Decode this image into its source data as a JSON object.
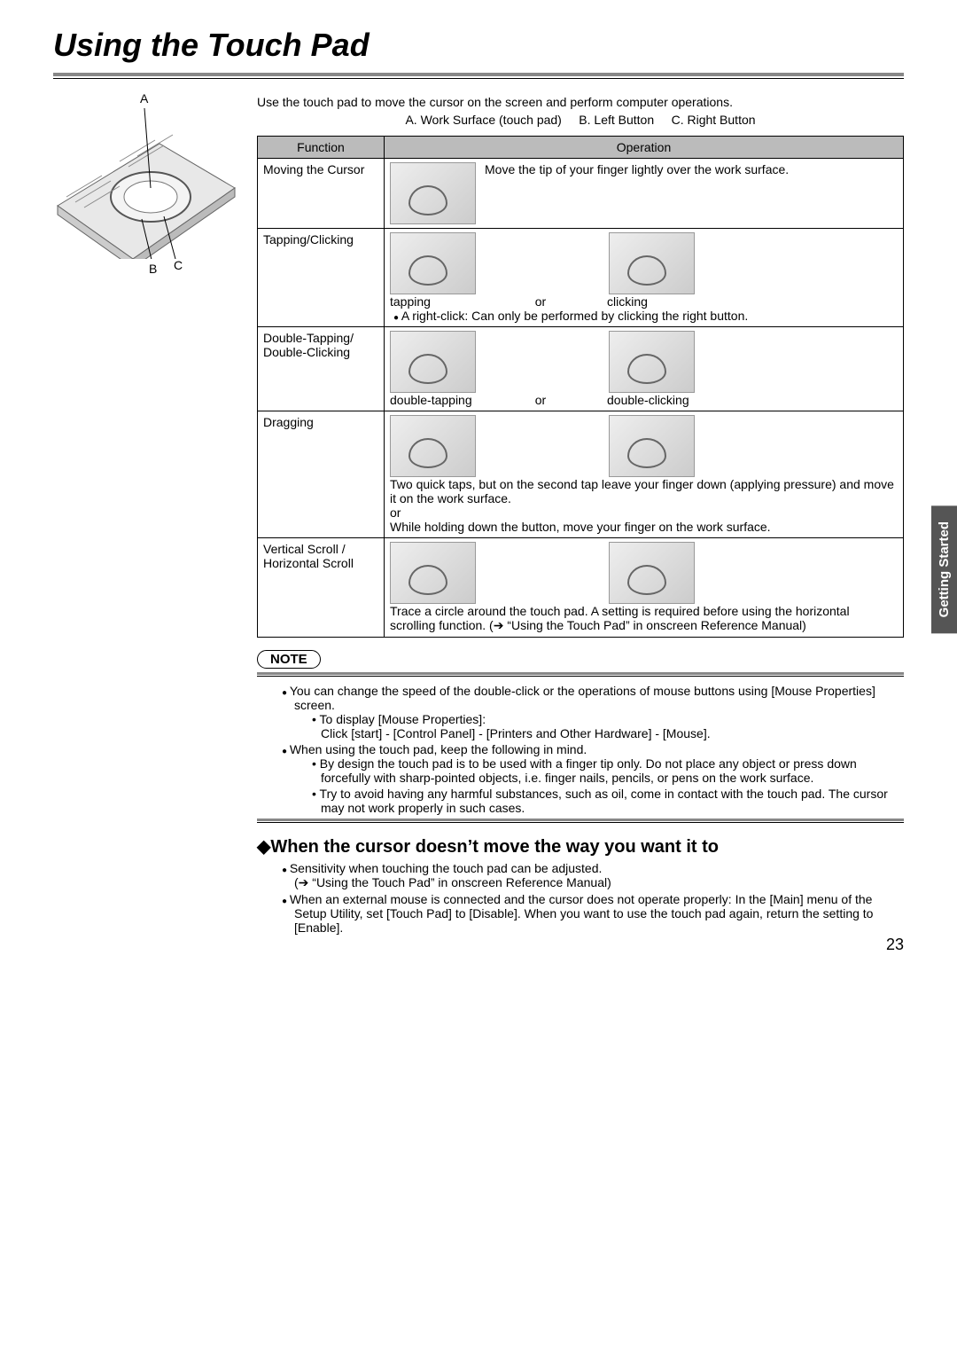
{
  "title": "Using the Touch Pad",
  "side_tab": "Getting Started",
  "page_number": "23",
  "diagram": {
    "labelA": "A",
    "labelB": "B",
    "labelC": "C"
  },
  "intro": "Use the touch pad to move the cursor on the screen and perform computer operations.",
  "legend": {
    "a": "A. Work Surface (touch pad)",
    "b": "B. Left Button",
    "c": "C. Right Button"
  },
  "table_head": {
    "function": "Function",
    "operation": "Operation"
  },
  "rows": {
    "r1": {
      "func": "Moving the Cursor",
      "desc": "Move the tip of your finger lightly over the work surface."
    },
    "r2": {
      "func": "Tapping/Clicking",
      "cap1": "tapping",
      "or": "or",
      "cap2": "clicking",
      "note": "A right-click: Can only be performed by clicking the right button."
    },
    "r3": {
      "func": "Double-Tapping/ Double-Clicking",
      "cap1": "double-tapping",
      "or": "or",
      "cap2": "double-clicking"
    },
    "r4": {
      "func": "Dragging",
      "desc1": "Two quick taps, but on the second tap leave your finger down (applying pressure) and move it on the work surface.",
      "or": "or",
      "desc2": "While holding down the button, move your finger on the work surface."
    },
    "r5": {
      "func": "Vertical Scroll / Horizontal Scroll",
      "desc": "Trace a circle around the touch pad. A setting is required before using the horizontal scrolling function. (➔ “Using the Touch Pad” in onscreen Reference Manual)"
    }
  },
  "note_label": "NOTE",
  "notes": {
    "n1": "You can change the speed of the double-click or the operations of mouse buttons using [Mouse Properties] screen.",
    "n1a": "To display [Mouse Properties]:",
    "n1b": "Click [start] - [Control Panel] - [Printers and Other Hardware] - [Mouse].",
    "n2": "When using the touch pad, keep the following in mind.",
    "n2a": "By design the touch pad is to be used with a finger tip only. Do not place any object or press down forcefully with sharp-pointed objects, i.e. finger nails, pencils, or pens on the work surface.",
    "n2b": "Try to avoid having any harmful substances, such as oil, come in contact with the touch pad. The cursor may not work properly in such cases."
  },
  "subheading": "When the cursor doesn’t move the way you want it to",
  "sub": {
    "s1": "Sensitivity when touching the touch pad can be adjusted.",
    "s1ref": "(➔ “Using the Touch Pad” in onscreen Reference Manual)",
    "s2": "When an external mouse is connected and the cursor does not operate properly: In the [Main] menu of the Setup Utility, set [Touch Pad] to [Disable]. When you want to use the touch pad again, return the setting to [Enable]."
  }
}
